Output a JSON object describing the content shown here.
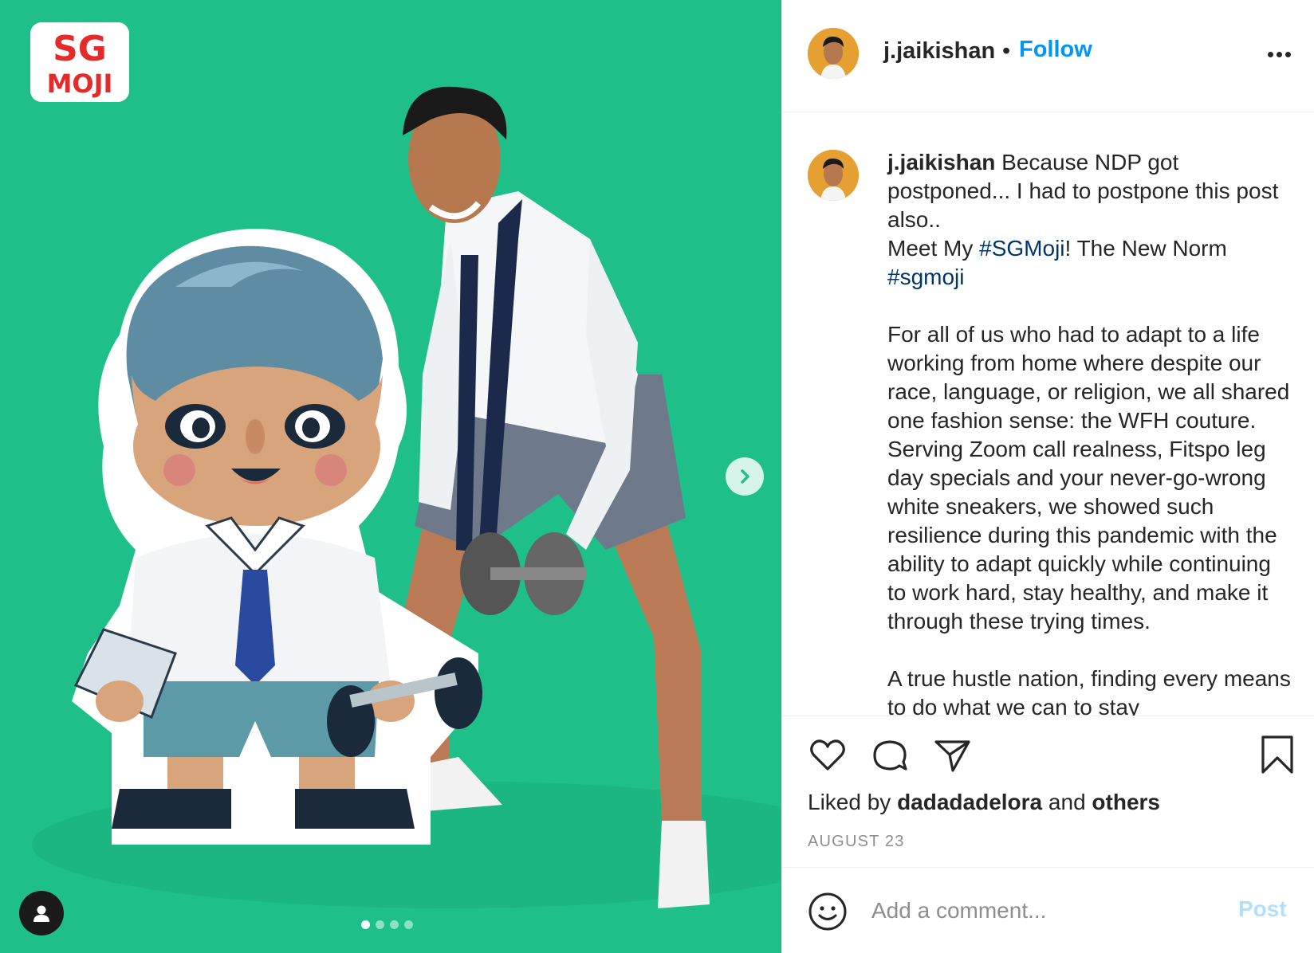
{
  "post": {
    "author": "j.jaikishan",
    "separator": "•",
    "follow_label": "Follow",
    "caption": {
      "username": "j.jaikishan",
      "line1_text": " Because NDP got postponed... I had to postpone this post also..",
      "line2_prefix": "Meet My ",
      "hashtag1": "#SGMoji",
      "line2_suffix": "! The New Norm ",
      "hashtag2": "#sgmoji",
      "para2": "For all of us who had to adapt to a life working from home where despite our race, language, or religion, we all shared one fashion sense: the WFH couture. Serving Zoom call realness, Fitspo leg day specials and your never-go-wrong white sneakers, we showed such resilience during this pandemic with the ability to adapt quickly while continuing to work hard, stay healthy, and make it through these trying times.",
      "para3": "A true hustle nation, finding every means to do what we can to stay"
    },
    "likes": {
      "prefix": "Liked by ",
      "user": "dadadadelora",
      "middle": " and ",
      "others": "others"
    },
    "date": "AUGUST 23",
    "comment": {
      "placeholder": "Add a comment...",
      "post_label": "Post"
    },
    "media": {
      "brand_logo_text_top": "SG",
      "brand_logo_text_bottom": "MOJI",
      "carousel_total": 4,
      "carousel_active_index": 0
    }
  },
  "colors": {
    "media_background": "#1fbf8a",
    "link": "#0095f6",
    "hashtag": "#00376b",
    "muted": "#8e8e8e",
    "post_button_disabled": "#b2dffc"
  },
  "icons": [
    "chevron-right-icon",
    "user-tag-icon",
    "heart-icon",
    "comment-icon",
    "share-icon",
    "bookmark-icon",
    "emoji-icon",
    "more-options-icon"
  ]
}
